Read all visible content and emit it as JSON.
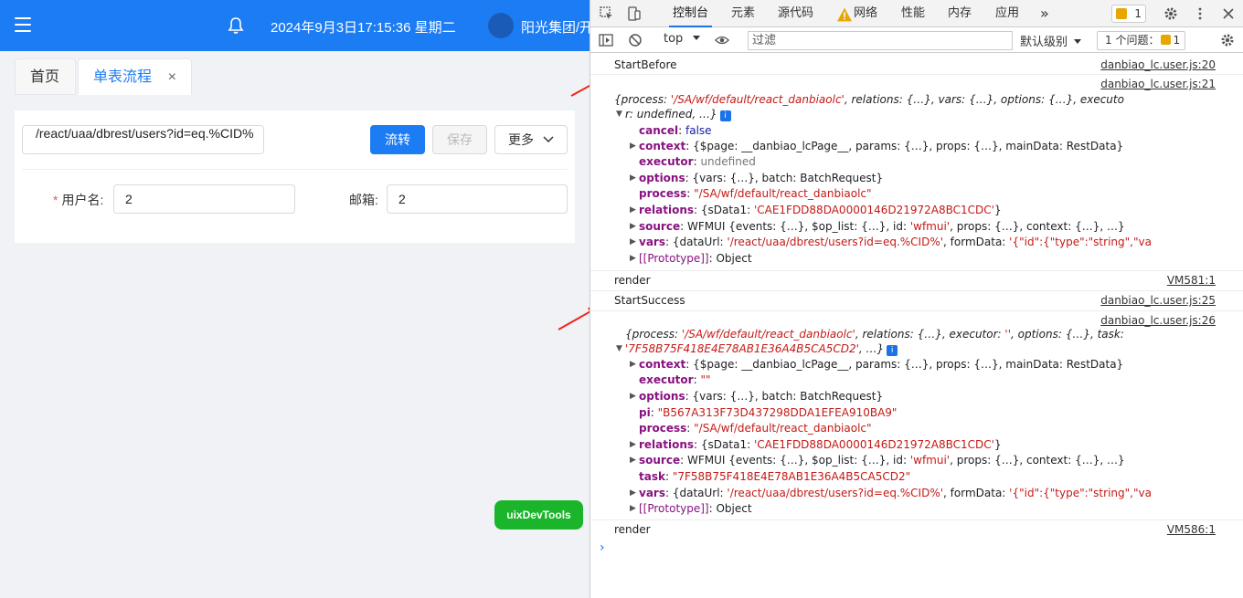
{
  "app": {
    "datetime": "2024年9月3日17:15:36 星期二",
    "org": "阳光集团/开",
    "tabs": [
      {
        "label": "首页"
      },
      {
        "label": "单表流程",
        "close": "×"
      }
    ],
    "form": {
      "url_value": "/react/uaa/dbrest/users?id=eq.%CID%",
      "buttons": {
        "flow": "流转",
        "save": "保存",
        "more": "更多"
      },
      "user_label": "用户名:",
      "required_mark": "*",
      "user_value": "2",
      "email_label": "邮箱:",
      "email_value": "2"
    },
    "uix_button": "uixDevTools"
  },
  "devtools": {
    "tabs": [
      "控制台",
      "元素",
      "源代码",
      "网络",
      "性能",
      "内存",
      "应用"
    ],
    "more": "»",
    "warn_count": "1",
    "toolbar": {
      "context": "top",
      "filter_placeholder": "过滤",
      "level": "默认级别",
      "issues": "1 个问题：",
      "issues_count": "1"
    },
    "log": [
      {
        "text": "StartBefore",
        "src": "danbiao_lc.user.js:20"
      },
      {
        "src": "danbiao_lc.user.js:21"
      },
      {
        "text": "render",
        "src": "VM581:1"
      },
      {
        "text": "StartSuccess",
        "src": "danbiao_lc.user.js:25"
      },
      {
        "src": "danbiao_lc.user.js:26"
      },
      {
        "text": "render",
        "src": "VM586:1"
      }
    ]
  }
}
